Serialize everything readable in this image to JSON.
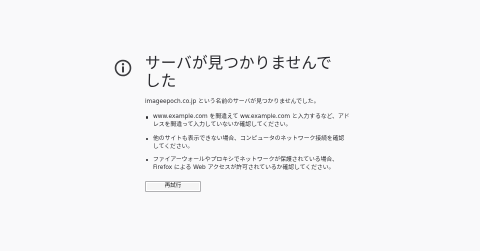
{
  "error": {
    "icon": "info-icon",
    "title": "サーバが見つかりませんでした",
    "description": "imageepoch.co.jp という名前のサーバが見つかりませんでした。",
    "tips": [
      "www.example.com を間違えて ww.example.com と入力するなど、アドレスを間違って入力していないか確認してください。",
      "他のサイトも表示できない場合、コンピュータのネットワーク接続を確認してください。",
      "ファイアーウォールやプロキシでネットワークが保護されている場合、Firefox による Web アクセスが許可されているか確認してください。"
    ],
    "retry_label": "再試行"
  }
}
